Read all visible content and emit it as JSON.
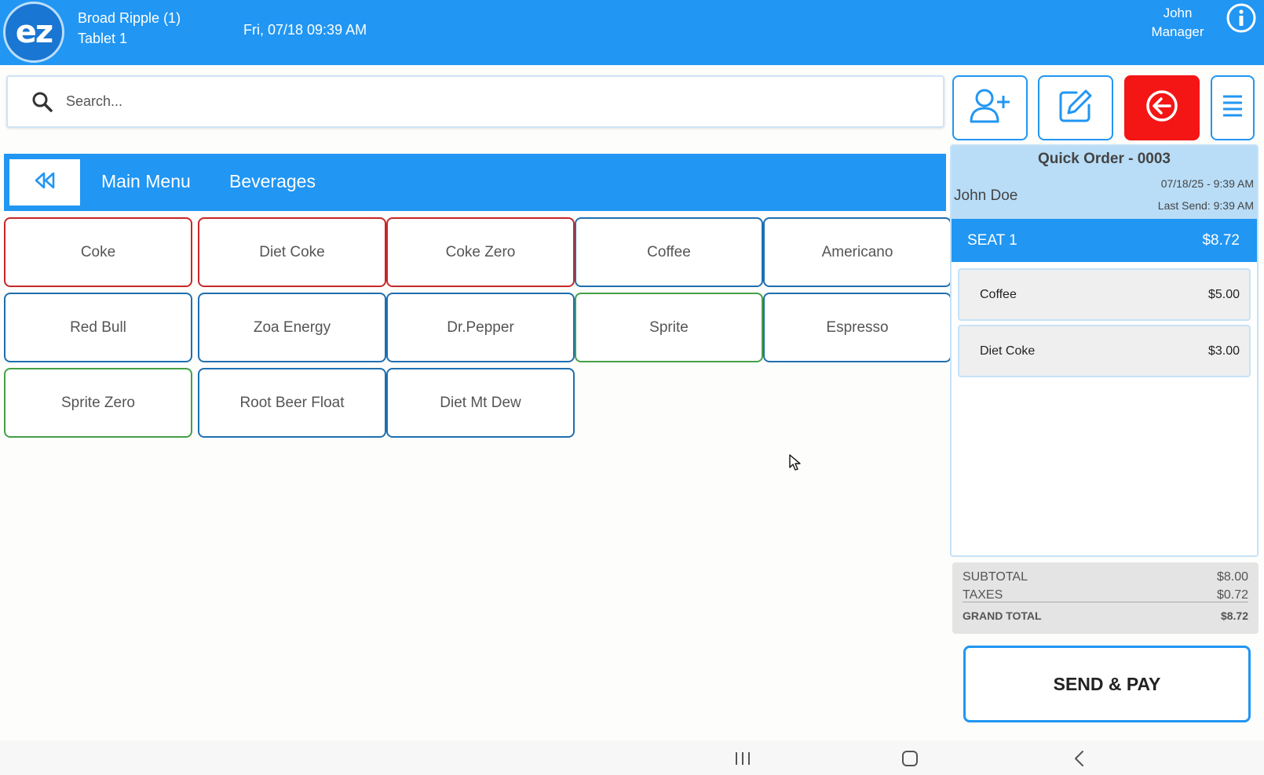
{
  "header": {
    "logo_text": "ez",
    "location_name": "Broad Ripple (1)",
    "device_name": "Tablet 1",
    "datetime": "Fri, 07/18 09:39 AM",
    "user_name": "John",
    "user_role": "Manager",
    "info_icon": "info-icon"
  },
  "search": {
    "placeholder": "Search...",
    "value": ""
  },
  "toolbar": {
    "icons": [
      "add-customer-icon",
      "edit-icon",
      "back-circle-icon",
      "menu-icon"
    ],
    "accent_color": "#f41515"
  },
  "category_bar": {
    "back_icon": "rewind-icon",
    "breadcrumbs": [
      "Main Menu",
      "Beverages"
    ]
  },
  "menu_items": [
    {
      "label": "Coke",
      "color": "red"
    },
    {
      "label": "Diet Coke",
      "color": "red"
    },
    {
      "label": "Coke Zero",
      "color": "red"
    },
    {
      "label": "Coffee",
      "color": "blue"
    },
    {
      "label": "Americano",
      "color": "blue"
    },
    {
      "label": "Red Bull",
      "color": "blue"
    },
    {
      "label": "Zoa Energy",
      "color": "blue"
    },
    {
      "label": "Dr.Pepper",
      "color": "blue"
    },
    {
      "label": "Sprite",
      "color": "green"
    },
    {
      "label": "Espresso",
      "color": "blue"
    },
    {
      "label": "Sprite Zero",
      "color": "green"
    },
    {
      "label": "Root Beer Float",
      "color": "blue"
    },
    {
      "label": "Diet Mt Dew",
      "color": "blue"
    }
  ],
  "order": {
    "title": "Quick Order - 0003",
    "customer": "John Doe",
    "date": "07/18/25 - 9:39 AM",
    "last_send": "Last Send: 9:39 AM",
    "seat_label": "SEAT 1",
    "seat_total": "$8.72",
    "lines": [
      {
        "name": "Coffee",
        "price": "$5.00"
      },
      {
        "name": "Diet Coke",
        "price": "$3.00"
      }
    ]
  },
  "totals": {
    "subtotal_label": "SUBTOTAL",
    "subtotal": "$8.00",
    "taxes_label": "TAXES",
    "taxes": "$0.72",
    "grand_label": "GRAND TOTAL",
    "grand": "$8.72"
  },
  "pay_button": "SEND & PAY",
  "colors": {
    "primary": "#2196f3",
    "danger": "#f41515",
    "item_red": "#c62828",
    "item_green": "#43a047",
    "item_blue": "#1e6fb0"
  }
}
